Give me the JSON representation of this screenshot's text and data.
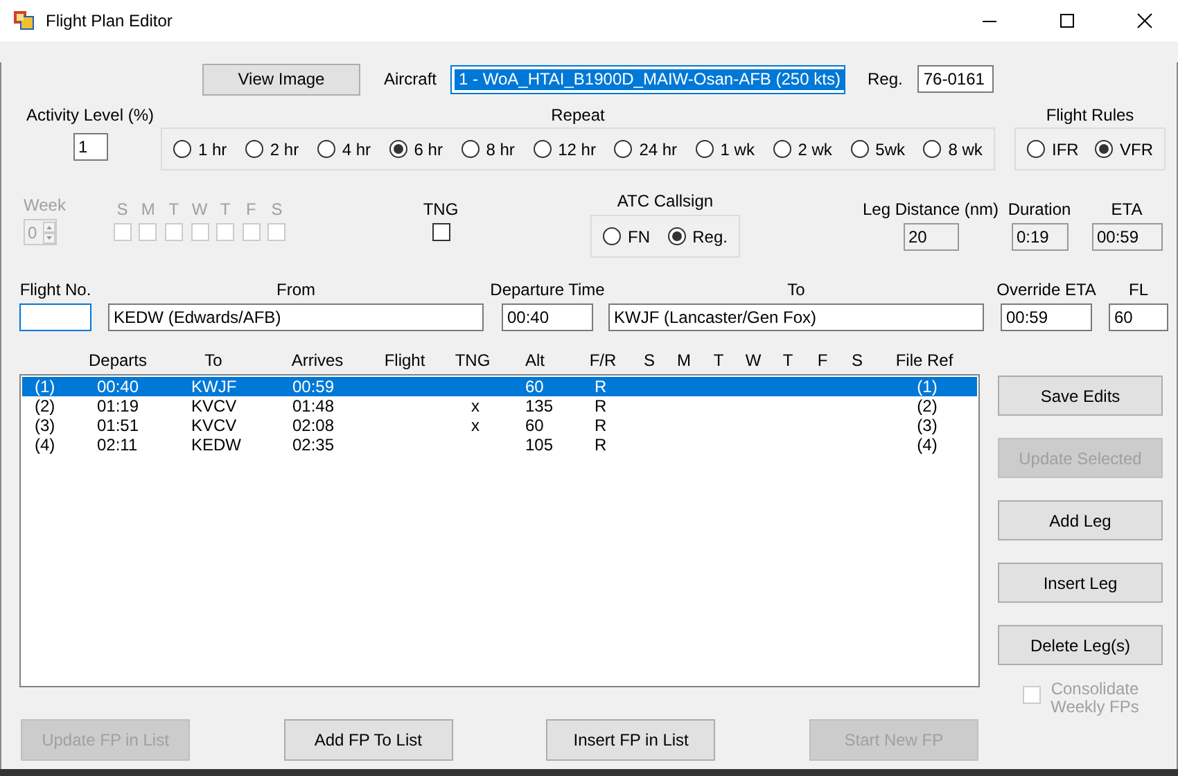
{
  "window": {
    "title": "Flight Plan Editor"
  },
  "view_image_button": {
    "label": "View Image"
  },
  "aircraft": {
    "label": "Aircraft",
    "value": "1 - WoA_HTAI_B1900D_MAIW-Osan-AFB (250 kts)",
    "selected": true
  },
  "reg": {
    "label": "Reg.",
    "value": "76-0161"
  },
  "activity_level": {
    "label": "Activity Level (%)",
    "value": "1"
  },
  "repeat": {
    "label": "Repeat",
    "options": [
      {
        "label": "1 hr",
        "selected": false
      },
      {
        "label": "2 hr",
        "selected": false
      },
      {
        "label": "4 hr",
        "selected": false
      },
      {
        "label": "6 hr",
        "selected": true
      },
      {
        "label": "8 hr",
        "selected": false
      },
      {
        "label": "12 hr",
        "selected": false
      },
      {
        "label": "24 hr",
        "selected": false
      },
      {
        "label": "1 wk",
        "selected": false
      },
      {
        "label": "2 wk",
        "selected": false
      },
      {
        "label": "5wk",
        "selected": false
      },
      {
        "label": "8 wk",
        "selected": false
      }
    ]
  },
  "flight_rules": {
    "label": "Flight Rules",
    "options": [
      {
        "label": "IFR",
        "selected": false
      },
      {
        "label": "VFR",
        "selected": true
      }
    ]
  },
  "week": {
    "label": "Week",
    "value": "0",
    "disabled": true
  },
  "days": {
    "disabled": true,
    "items": [
      {
        "label": "S",
        "checked": false
      },
      {
        "label": "M",
        "checked": false
      },
      {
        "label": "T",
        "checked": false
      },
      {
        "label": "W",
        "checked": false
      },
      {
        "label": "T",
        "checked": false
      },
      {
        "label": "F",
        "checked": false
      },
      {
        "label": "S",
        "checked": false
      }
    ]
  },
  "tng": {
    "label": "TNG",
    "checked": false
  },
  "atc_callsign": {
    "label": "ATC Callsign",
    "options": [
      {
        "label": "FN",
        "selected": false
      },
      {
        "label": "Reg.",
        "selected": true
      }
    ]
  },
  "leg_distance": {
    "label": "Leg Distance (nm)",
    "value": "20"
  },
  "duration": {
    "label": "Duration",
    "value": "0:19"
  },
  "eta": {
    "label": "ETA",
    "value": "00:59"
  },
  "flight_no": {
    "label": "Flight No.",
    "focused": true
  },
  "from": {
    "label": "From",
    "value": "KEDW (Edwards/AFB)"
  },
  "departure_time": {
    "label": "Departure Time",
    "value": "00:40"
  },
  "to": {
    "label": "To",
    "value": "KWJF (Lancaster/Gen Fox)"
  },
  "override_eta": {
    "label": "Override ETA",
    "value": "00:59"
  },
  "fl": {
    "label": "FL",
    "value": "60"
  },
  "legs": {
    "columns": [
      "",
      "Departs",
      "To",
      "Arrives",
      "Flight",
      "TNG",
      "Alt",
      "F/R",
      "S",
      "M",
      "T",
      "W",
      "T",
      "F",
      "S",
      "File Ref"
    ],
    "rows": [
      {
        "cells": [
          "(1)",
          "00:40",
          "KWJF",
          "00:59",
          null,
          null,
          "60",
          "R",
          null,
          null,
          null,
          null,
          null,
          null,
          null,
          "(1)"
        ],
        "selected": true
      },
      {
        "cells": [
          "(2)",
          "01:19",
          "KVCV",
          "01:48",
          null,
          "x",
          "135",
          "R",
          null,
          null,
          null,
          null,
          null,
          null,
          null,
          "(2)"
        ],
        "selected": false
      },
      {
        "cells": [
          "(3)",
          "01:51",
          "KVCV",
          "02:08",
          null,
          "x",
          "60",
          "R",
          null,
          null,
          null,
          null,
          null,
          null,
          null,
          "(3)"
        ],
        "selected": false
      },
      {
        "cells": [
          "(4)",
          "02:11",
          "KEDW",
          "02:35",
          null,
          null,
          "105",
          "R",
          null,
          null,
          null,
          null,
          null,
          null,
          null,
          "(4)"
        ],
        "selected": false
      }
    ]
  },
  "side_buttons": [
    {
      "label": "Save Edits",
      "disabled": false
    },
    {
      "label": "Update Selected",
      "disabled": true
    },
    {
      "label": "Add Leg",
      "disabled": false
    },
    {
      "label": "Insert Leg",
      "disabled": false
    },
    {
      "label": "Delete Leg(s)",
      "disabled": false
    }
  ],
  "consolidate": {
    "label": "Consolidate Weekly FPs",
    "checked": false,
    "disabled": true
  },
  "bottom_buttons": [
    {
      "label": "Update FP in List",
      "disabled": true
    },
    {
      "label": "Add FP To List",
      "disabled": false
    },
    {
      "label": "Insert FP in List",
      "disabled": false
    },
    {
      "label": "Start New FP",
      "disabled": true
    }
  ]
}
